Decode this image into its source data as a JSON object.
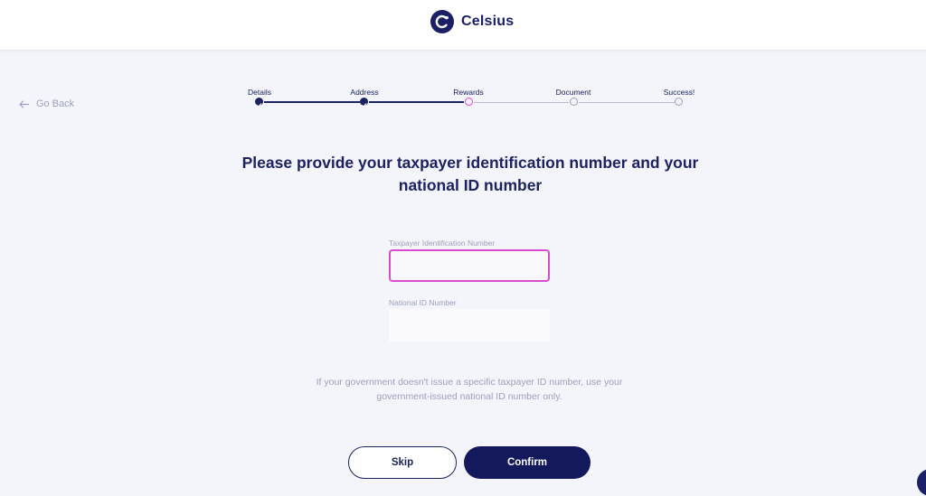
{
  "brand": {
    "name": "Celsius"
  },
  "nav": {
    "back_label": "Go Back"
  },
  "stepper": {
    "steps": [
      {
        "label": "Details",
        "state": "done"
      },
      {
        "label": "Address",
        "state": "done"
      },
      {
        "label": "Rewards",
        "state": "current"
      },
      {
        "label": "Document",
        "state": "todo"
      },
      {
        "label": "Success!",
        "state": "todo"
      }
    ]
  },
  "heading": {
    "part1": "Please provide ",
    "bold1": "your taxpayer identification number",
    "part2": " and ",
    "bold2": "your national ID number"
  },
  "form": {
    "taxpayer_label": "Taxpayer Identification Number",
    "taxpayer_value": "",
    "national_label": "National ID Number",
    "national_value": ""
  },
  "hint": "If your government doesn't issue a specific taxpayer ID number, use your government-issued national ID number only.",
  "buttons": {
    "skip": "Skip",
    "confirm": "Confirm"
  },
  "colors": {
    "brand": "#1a1f66",
    "accent_pink": "#d94bd1",
    "muted": "#9ba0bd",
    "background": "#f4f5fb"
  }
}
